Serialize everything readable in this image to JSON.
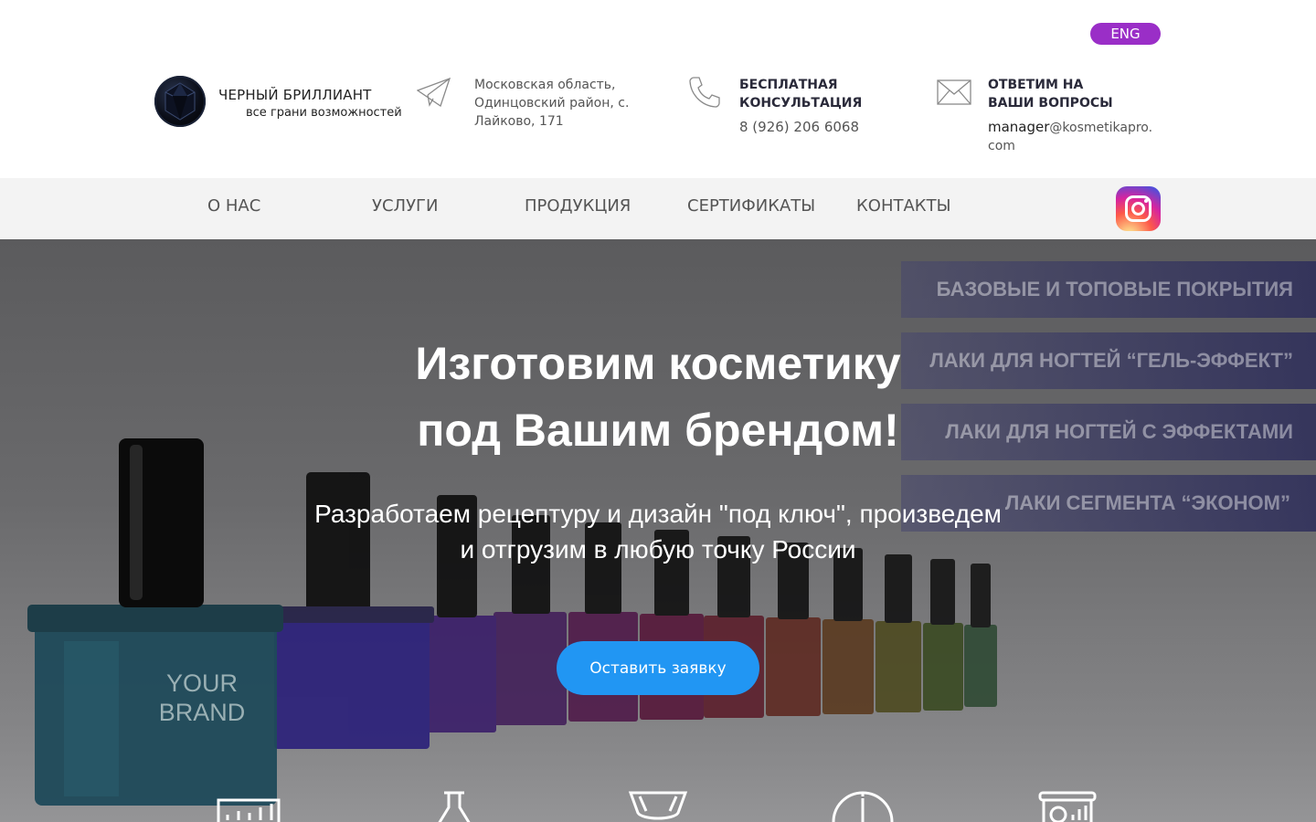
{
  "header": {
    "lang_label": "ENG",
    "logo": {
      "name": "ЧЕРНЫЙ БРИЛЛИАНТ",
      "tagline": "все грани возможностей"
    },
    "address": {
      "icon": "paper-plane-icon",
      "lines": [
        "Московская область,",
        "Одинцовский район, с.",
        "Лайково, 171"
      ]
    },
    "consult": {
      "icon": "phone-icon",
      "title_lines": [
        "БЕСПЛАТНАЯ",
        "КОНСУЛЬТАЦИЯ"
      ],
      "phone": "8 (926) 206 6068"
    },
    "mail": {
      "icon": "envelope-icon",
      "title_lines": [
        "ОТВЕТИМ НА",
        "ВАШИ ВОПРОСЫ"
      ],
      "email_user": "manager",
      "email_domain": "@kosmetikapro.com"
    }
  },
  "nav": {
    "items": [
      "О НАС",
      "УСЛУГИ",
      "ПРОДУКЦИЯ",
      "СЕРТИФИКАТЫ",
      "КОНТАКТЫ"
    ],
    "social_icon": "instagram-icon"
  },
  "hero": {
    "title_lines": [
      "Изготовим косметику",
      "под Вашим брендом!"
    ],
    "subtitle_lines": [
      "Разработаем рецептуру и дизайн \"под ключ\", произведем",
      "и отгрузим в любую точку России"
    ],
    "cta_label": "Оставить заявку",
    "bottle_label_lines": [
      "YOUR",
      "BRAND"
    ],
    "categories": [
      "БАЗОВЫЕ И ТОПОВЫЕ ПОКРЫТИЯ",
      "ЛАКИ ДЛЯ НОГТЕЙ “ГЕЛЬ-ЭФФЕКТ”",
      "ЛАКИ ДЛЯ НОГТЕЙ С ЭФФЕКТАМИ",
      "ЛАКИ СЕГМЕНТА “ЭКОНОМ”"
    ],
    "feature_icons": [
      "chart-icon",
      "flask-icon",
      "trophy-icon",
      "clock-icon",
      "analytics-board-icon"
    ]
  },
  "colors": {
    "lang_bg": "#9a2ec7",
    "cta_bg": "#2196f3",
    "nav_bg": "#f3f3f3"
  }
}
